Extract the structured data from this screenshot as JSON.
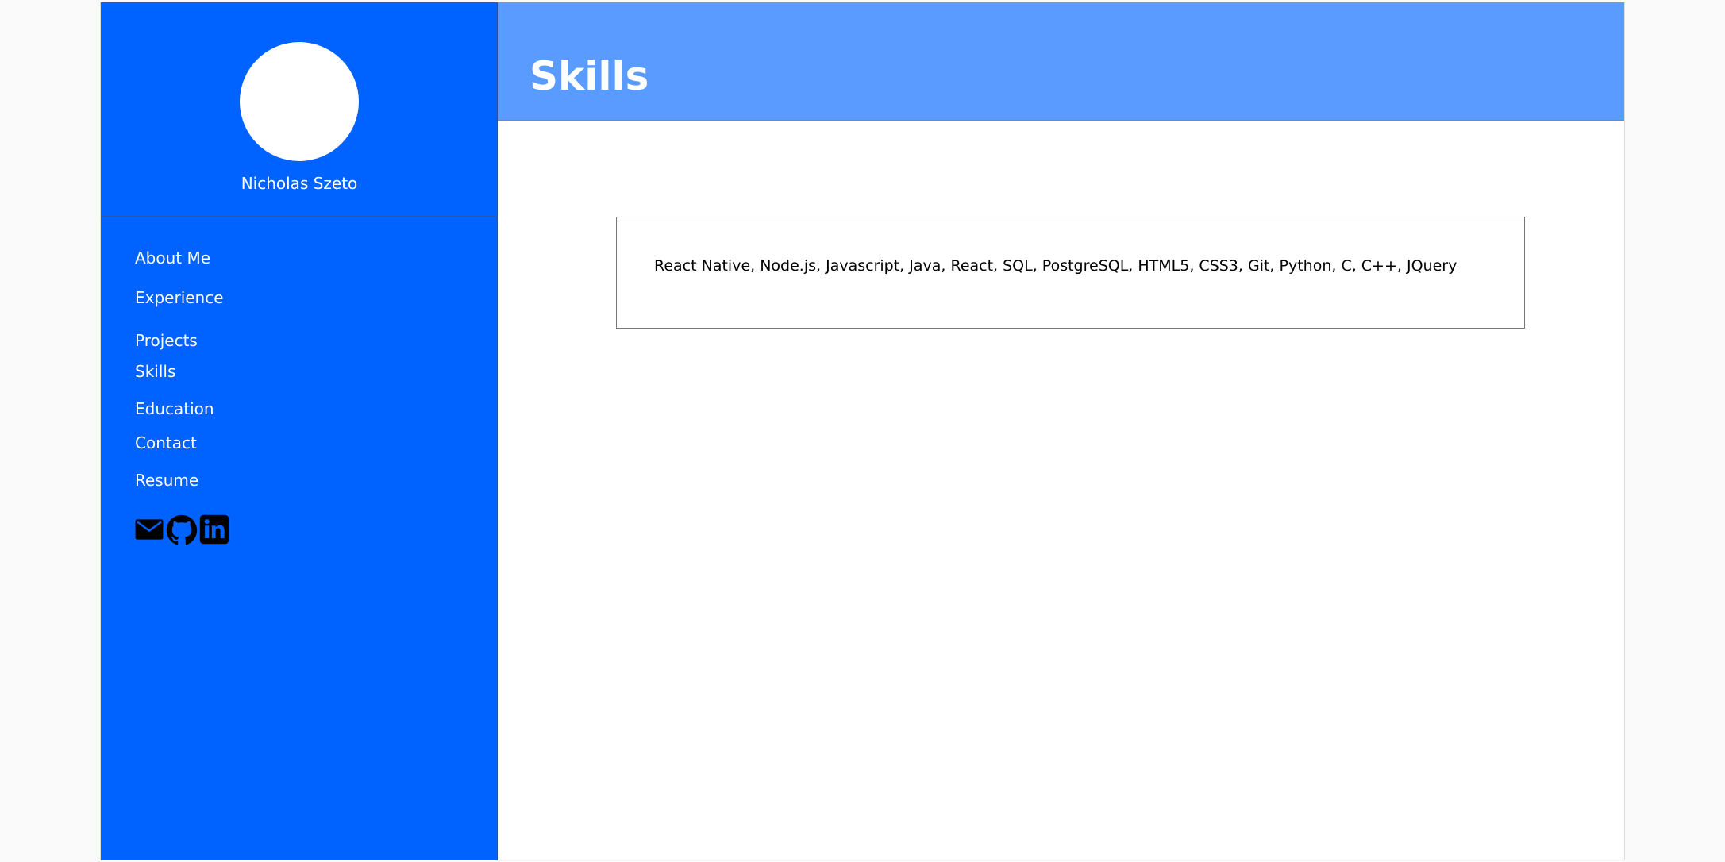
{
  "profile": {
    "name": "Nicholas Szeto"
  },
  "nav": {
    "items": [
      {
        "label": "About Me"
      },
      {
        "label": "Experience"
      },
      {
        "label": "Projects"
      },
      {
        "label": "Skills"
      },
      {
        "label": "Education"
      },
      {
        "label": "Contact"
      },
      {
        "label": "Resume"
      }
    ]
  },
  "social": [
    {
      "icon": "mail-icon"
    },
    {
      "icon": "github-icon"
    },
    {
      "icon": "linkedin-icon"
    }
  ],
  "header": {
    "title": "Skills"
  },
  "skills": {
    "text": "React Native, Node.js, Javascript, Java, React, SQL, PostgreSQL, HTML5, CSS3, Git, Python, C, C++, JQuery"
  },
  "colors": {
    "sidebar": "#0062ff",
    "header": "#5a9bff",
    "text_light": "#ffffff"
  }
}
